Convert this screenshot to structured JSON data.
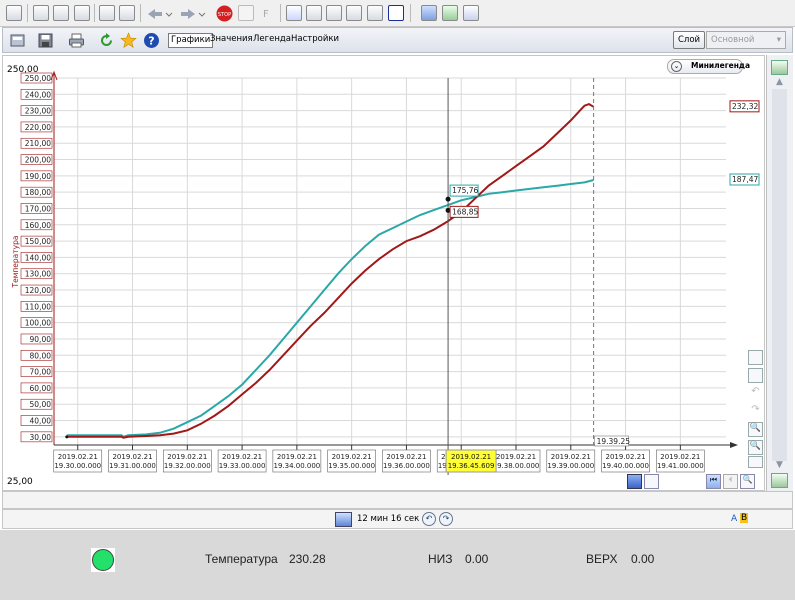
{
  "toolbar2": {
    "tabs": [
      {
        "label": "Графики",
        "active": true
      },
      {
        "label": "Значения",
        "active": false
      },
      {
        "label": "Легенда",
        "active": false
      },
      {
        "label": "Настройки",
        "active": false
      }
    ],
    "layer_button": "Слой",
    "layer_select": "Основной"
  },
  "chart": {
    "minilegend_label": "Минилегенда",
    "ymax_label": "250,00",
    "ymin_label": "25,00",
    "ylabel": "Температура",
    "colors": {
      "red": "#a01818",
      "teal": "#2aa8a8"
    },
    "cursor_time": "2019.02.21\n19.36.45.609",
    "cursor_values": {
      "teal": "175,76",
      "red": "168,85"
    },
    "end_time_label": "19.39.25",
    "end_values": {
      "red": "232,32",
      "teal": "187,47"
    }
  },
  "chart_data": {
    "type": "line",
    "ylabel": "Температура",
    "ylim": [
      25,
      250
    ],
    "yticks": [
      "30,00",
      "40,00",
      "50,00",
      "60,00",
      "70,00",
      "80,00",
      "90,00",
      "100,00",
      "110,00",
      "120,00",
      "130,00",
      "140,00",
      "150,00",
      "160,00",
      "170,00",
      "180,00",
      "190,00",
      "200,00",
      "210,00",
      "220,00",
      "230,00",
      "240,00",
      "250,00"
    ],
    "xtick_labels": [
      "2019.02.21 19.30.00.000",
      "2019.02.21 19.31.00.000",
      "2019.02.21 19.32.00.000",
      "2019.02.21 19.33.00.000",
      "2019.02.21 19.34.00.000",
      "2019.02.21 19.35.00.000",
      "2019.02.21 19.36.00.000",
      "2019.02.21 19.37.00.000",
      "2019.02.21 19.38.00.000",
      "2019.02.21 19.39.00.000",
      "2019.02.21 19.40.00.000",
      "2019.02.21 19.41.00.000"
    ],
    "xlim": [
      "19:29:34",
      "19:41:50"
    ],
    "grid": true,
    "series": [
      {
        "name": "teal",
        "color": "#2aa8a8",
        "points": [
          [
            "19:29:48",
            31
          ],
          [
            "19:30:48",
            31
          ],
          [
            "19:30:50",
            30
          ],
          [
            "19:30:55",
            31
          ],
          [
            "19:31:15",
            31.5
          ],
          [
            "19:31:30",
            32.5
          ],
          [
            "19:31:45",
            35
          ],
          [
            "19:32:00",
            39
          ],
          [
            "19:32:15",
            43
          ],
          [
            "19:32:30",
            49
          ],
          [
            "19:32:45",
            55
          ],
          [
            "19:33:00",
            62
          ],
          [
            "19:33:15",
            71
          ],
          [
            "19:33:30",
            80
          ],
          [
            "19:33:45",
            90
          ],
          [
            "19:34:00",
            100
          ],
          [
            "19:34:15",
            110
          ],
          [
            "19:34:30",
            120
          ],
          [
            "19:34:45",
            130
          ],
          [
            "19:35:00",
            139
          ],
          [
            "19:35:15",
            147
          ],
          [
            "19:35:30",
            154
          ],
          [
            "19:35:45",
            158
          ],
          [
            "19:36:00",
            162
          ],
          [
            "19:36:15",
            166
          ],
          [
            "19:36:30",
            169
          ],
          [
            "19:36:45",
            172
          ],
          [
            "19:37:00",
            175
          ],
          [
            "19:37:15",
            177
          ],
          [
            "19:37:30",
            179
          ],
          [
            "19:37:45",
            180
          ],
          [
            "19:38:00",
            181
          ],
          [
            "19:38:15",
            182
          ],
          [
            "19:38:30",
            183
          ],
          [
            "19:38:45",
            184
          ],
          [
            "19:39:00",
            185
          ],
          [
            "19:39:15",
            186
          ],
          [
            "19:39:25",
            187.47
          ]
        ]
      },
      {
        "name": "red",
        "color": "#a01818",
        "points": [
          [
            "19:29:48",
            30
          ],
          [
            "19:30:48",
            30
          ],
          [
            "19:30:50",
            29.5
          ],
          [
            "19:30:55",
            30
          ],
          [
            "19:31:15",
            30.5
          ],
          [
            "19:31:30",
            31
          ],
          [
            "19:31:45",
            32
          ],
          [
            "19:32:00",
            34
          ],
          [
            "19:32:15",
            38
          ],
          [
            "19:32:30",
            43
          ],
          [
            "19:32:45",
            49
          ],
          [
            "19:33:00",
            56
          ],
          [
            "19:33:15",
            63
          ],
          [
            "19:33:30",
            71
          ],
          [
            "19:33:45",
            80
          ],
          [
            "19:34:00",
            89
          ],
          [
            "19:34:15",
            98
          ],
          [
            "19:34:30",
            106
          ],
          [
            "19:34:45",
            115
          ],
          [
            "19:35:00",
            124
          ],
          [
            "19:35:15",
            132
          ],
          [
            "19:35:30",
            139
          ],
          [
            "19:35:45",
            145
          ],
          [
            "19:36:00",
            150
          ],
          [
            "19:36:15",
            153
          ],
          [
            "19:36:30",
            157
          ],
          [
            "19:36:45",
            162
          ],
          [
            "19:37:00",
            168
          ],
          [
            "19:37:15",
            176
          ],
          [
            "19:37:30",
            184
          ],
          [
            "19:37:45",
            190
          ],
          [
            "19:38:00",
            196
          ],
          [
            "19:38:15",
            202
          ],
          [
            "19:38:30",
            208
          ],
          [
            "19:38:45",
            216
          ],
          [
            "19:39:00",
            224
          ],
          [
            "19:39:10",
            230
          ],
          [
            "19:39:15",
            233
          ],
          [
            "19:39:20",
            234
          ],
          [
            "19:39:25",
            232.32
          ]
        ]
      }
    ]
  },
  "navbar": {
    "duration": "12 мин 16 сек",
    "ab_a": "A",
    "ab_b": "B"
  },
  "status": {
    "indicator_color": "#22e06a",
    "temp_label": "Температура",
    "temp_value": "230.28",
    "low_label": "НИЗ",
    "low_value": "0.00",
    "high_label": "ВЕРХ",
    "high_value": "0.00"
  },
  "icons": [
    "save-icon",
    "print-icon",
    "refresh-icon",
    "star-icon",
    "help-icon",
    "stop-icon",
    "back-icon",
    "forward-icon",
    "home-icon",
    "zoom-in-icon",
    "zoom-out-icon"
  ]
}
